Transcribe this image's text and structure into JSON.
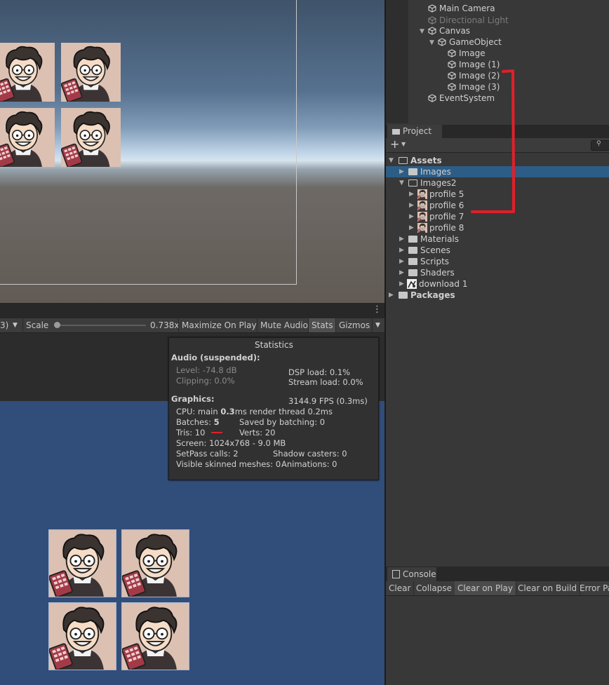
{
  "hierarchy": {
    "items": [
      {
        "label": "Main Camera"
      },
      {
        "label": "Directional Light"
      },
      {
        "label": "Canvas"
      },
      {
        "label": "GameObject"
      },
      {
        "label": "Image"
      },
      {
        "label": "Image (1)"
      },
      {
        "label": "Image (2)"
      },
      {
        "label": "Image (3)"
      },
      {
        "label": "EventSystem"
      }
    ]
  },
  "project": {
    "tab_label": "Project",
    "add_label": "+",
    "tree": [
      {
        "label": "Assets"
      },
      {
        "label": "Images"
      },
      {
        "label": "Images2"
      },
      {
        "label": "profile 5"
      },
      {
        "label": "profile 6"
      },
      {
        "label": "profile 7"
      },
      {
        "label": "profile 8"
      },
      {
        "label": "Materials"
      },
      {
        "label": "Scenes"
      },
      {
        "label": "Scripts"
      },
      {
        "label": "Shaders"
      },
      {
        "label": "download 1"
      },
      {
        "label": "Packages"
      }
    ]
  },
  "game_toolbar": {
    "display_suffix": "3)",
    "scale_label": "Scale",
    "scale_value": "0.738x",
    "scale_fraction": 0.0,
    "maximize_label": "Maximize On Play",
    "mute_label": "Mute Audio",
    "stats_label": "Stats",
    "gizmos_label": "Gizmos"
  },
  "stats": {
    "title": "Statistics",
    "audio_header": "Audio (suspended):",
    "level": "Level: -74.8 dB",
    "clipping": "Clipping: 0.0%",
    "dsp_load": "DSP load: 0.1%",
    "stream_load": "Stream load: 0.0%",
    "graphics_header": "Graphics:",
    "fps": "3144.9 FPS (0.3ms)",
    "cpu_prefix": "CPU: main ",
    "cpu_main": "0.3",
    "cpu_suffix": "ms  render thread 0.2ms",
    "batches_prefix": "Batches: ",
    "batches_value": "5",
    "saved_batching": "Saved by batching: 0",
    "tris": "Tris: 10",
    "verts": "Verts: 20",
    "screen": "Screen: 1024x768 - 9.0 MB",
    "setpass": "SetPass calls: 2",
    "shadow_casters": "Shadow casters: 0",
    "skinned": "Visible skinned meshes: 0",
    "animations": "Animations: 0"
  },
  "console": {
    "tab_label": "Console",
    "clear": "Clear",
    "collapse": "Collapse",
    "clear_on_play": "Clear on Play",
    "clear_on_build": "Clear on Build",
    "error_pause": "Error Pa"
  },
  "colors": {
    "annotation": "#e0202a",
    "selection": "#2c5d87",
    "game_background": "#314d7a"
  }
}
